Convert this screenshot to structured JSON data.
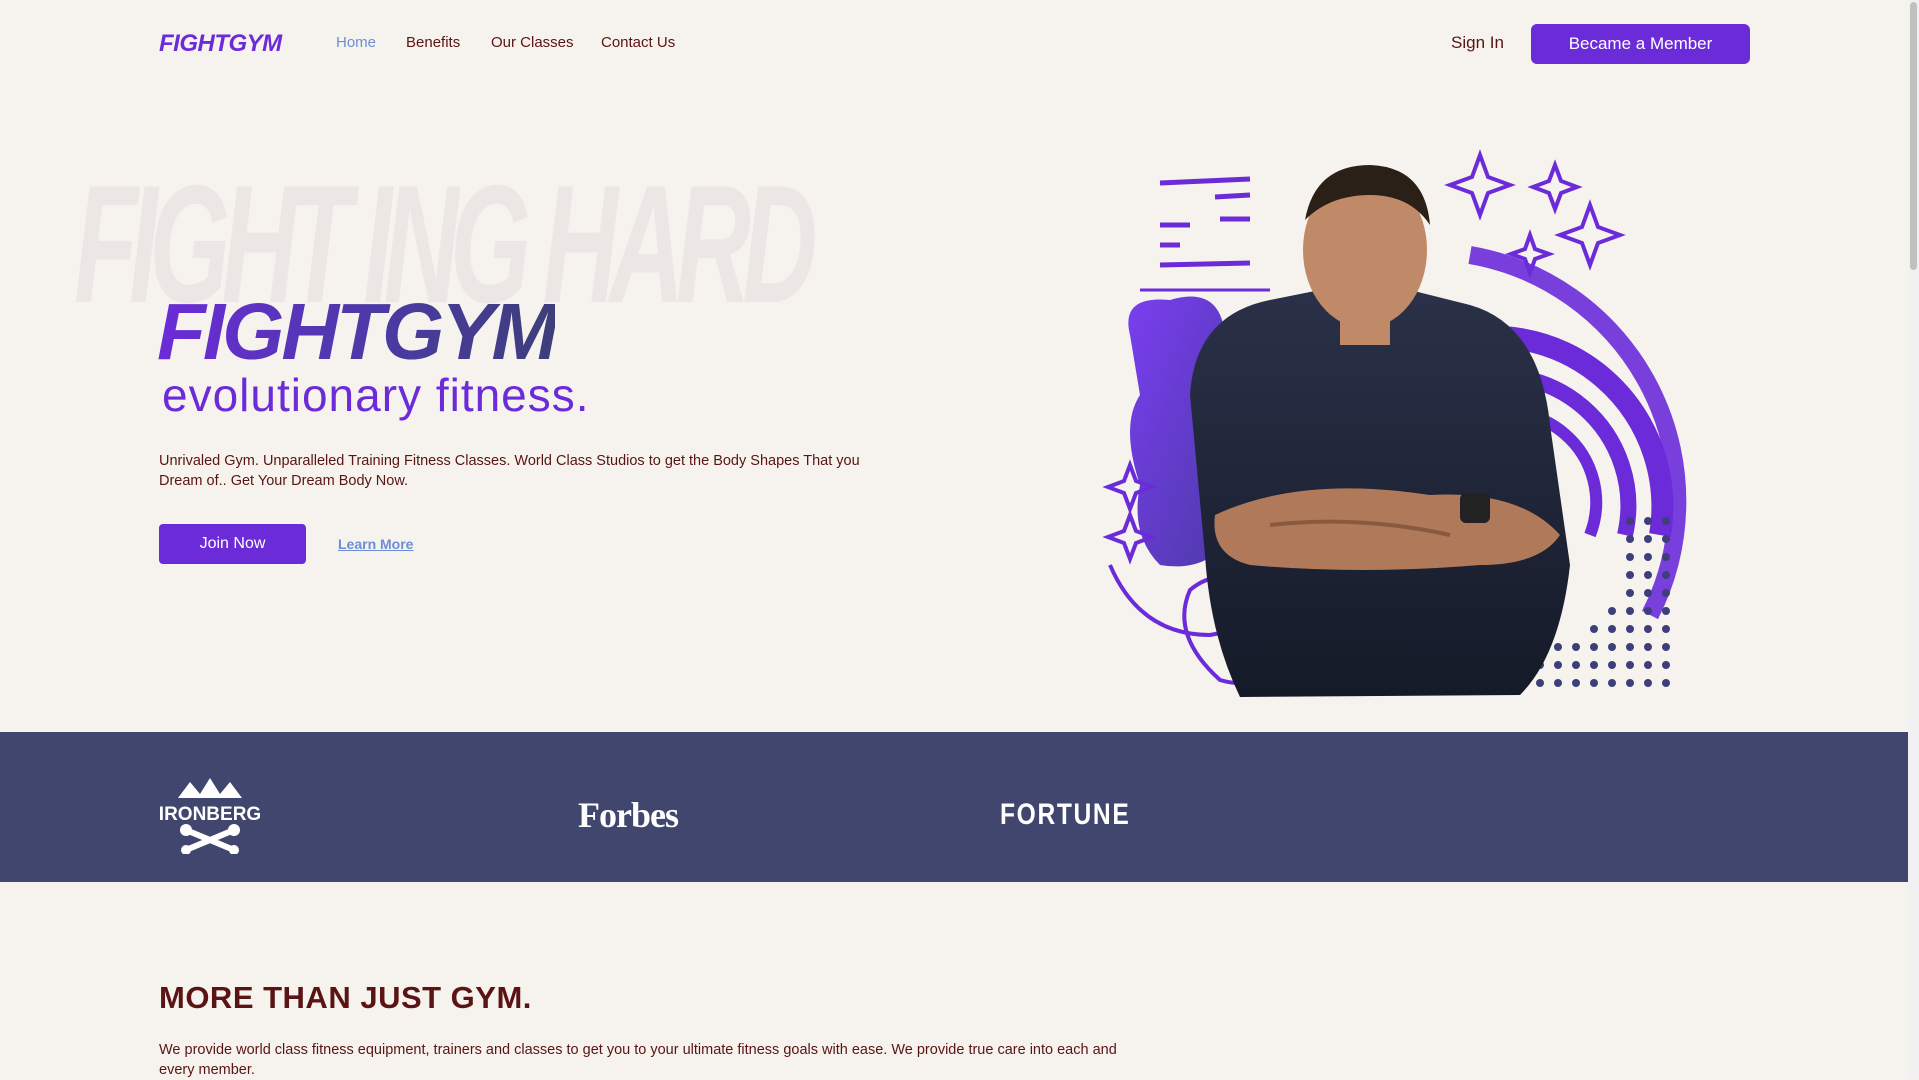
{
  "nav": {
    "logo": "FIGHTGYM",
    "links": [
      "Home",
      "Benefits",
      "Our Classes",
      "Contact Us"
    ],
    "active": "Home",
    "signin": "Sign In",
    "member_button": "Became a Member"
  },
  "hero": {
    "bg_text": "FIGHT ING HARD",
    "title": "FIGHTGYM",
    "subtitle": "evolutionary fitness.",
    "description": "Unrivaled Gym. Unparalleled Training Fitness Classes. World Class Studios to get the Body Shapes That you Dream of.. Get Your Dream Body Now.",
    "join_button": "Join Now",
    "learn_link": "Learn More"
  },
  "brands": {
    "ironberg": "IRONBERG",
    "forbes": "Forbes",
    "fortune": "FORTUNE"
  },
  "more": {
    "title": "MORE THAN JUST GYM.",
    "description": "We provide world class fitness equipment, trainers and classes to get you to your ultimate fitness goals with ease. We provide true care into each and every member."
  },
  "colors": {
    "accent": "#6c2bd9",
    "text": "#5a1414",
    "link": "#6b8fd6",
    "band": "#40466e",
    "background": "#f6f3ee"
  }
}
